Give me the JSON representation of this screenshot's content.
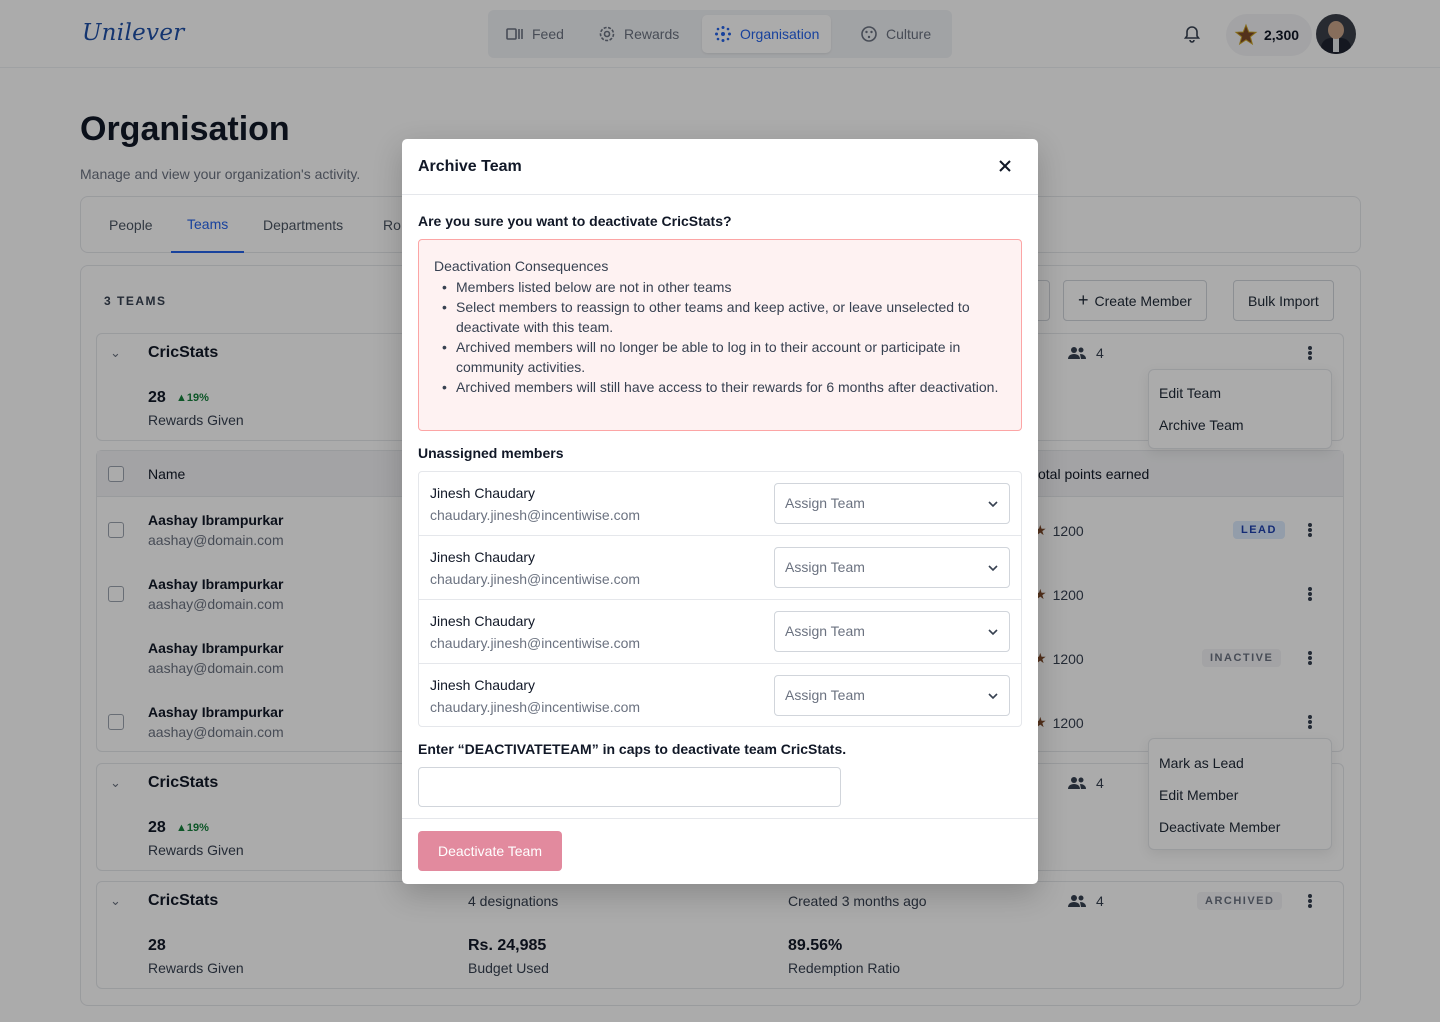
{
  "brand": "Unilever",
  "nav": [
    {
      "label": "Feed",
      "icon": "feed-icon"
    },
    {
      "label": "Rewards",
      "icon": "gear-icon"
    },
    {
      "label": "Organisation",
      "icon": "organisation-icon",
      "active": true
    },
    {
      "label": "Culture",
      "icon": "culture-icon"
    }
  ],
  "points": "2,300",
  "page": {
    "title": "Organisation",
    "subtitle": "Manage and view your organization's activity."
  },
  "tabs": [
    "People",
    "Teams",
    "Departments",
    "Ro"
  ],
  "teams_panel": {
    "count_label": "3 TEAMS",
    "create_member": "Create Member",
    "bulk_import": "Bulk Import",
    "teams": [
      {
        "name": "CricStats",
        "rewards_value": "28",
        "rewards_change": "▲19%",
        "rewards_label": "Rewards Given",
        "members": "4"
      },
      {
        "name": "CricStats",
        "rewards_value": "28",
        "rewards_change": "▲19%",
        "rewards_label": "Rewards Given",
        "members": "4"
      },
      {
        "name": "CricStats",
        "designations": "4 designations",
        "created": "Created 3 months ago",
        "members": "4",
        "status": "ARCHIVED",
        "rewards_value": "28",
        "rewards_label": "Rewards Given",
        "budget_value": "Rs. 24,985",
        "budget_label": "Budget Used",
        "ratio_value": "89.56%",
        "ratio_label": "Redemption Ratio"
      }
    ],
    "member_table": {
      "col_name": "Name",
      "col_points": "otal points earned",
      "rows": [
        {
          "name": "Aashay Ibrampurkar",
          "email": "aashay@domain.com",
          "points": "1200",
          "badge": "LEAD"
        },
        {
          "name": "Aashay Ibrampurkar",
          "email": "aashay@domain.com",
          "points": "1200",
          "badge": ""
        },
        {
          "name": "Aashay Ibrampurkar",
          "email": "aashay@domain.com",
          "points": "1200",
          "badge": "INACTIVE"
        },
        {
          "name": "Aashay Ibrampurkar",
          "email": "aashay@domain.com",
          "points": "1200",
          "badge": ""
        }
      ]
    },
    "team_menu": [
      "Edit Team",
      "Archive Team"
    ],
    "member_menu": [
      "Mark as Lead",
      "Edit Member",
      "Deactivate Member"
    ]
  },
  "modal": {
    "title": "Archive Team",
    "question": "Are you sure you want to deactivate CricStats?",
    "alert_title": "Deactivation Consequences",
    "consequences": [
      "Members listed below are not in other teams",
      "Select members to reassign to other teams and keep active, or leave unselected to deactivate with this team.",
      "Archived members will no longer be able to log in to their account or participate in community activities.",
      "Archived members will still have access to their rewards for 6 months after deactivation."
    ],
    "unassigned_title": "Unassigned members",
    "members": [
      {
        "name": "Jinesh Chaudary",
        "email": "chaudary.jinesh@incentiwise.com",
        "select": "Assign Team"
      },
      {
        "name": "Jinesh Chaudary",
        "email": "chaudary.jinesh@incentiwise.com",
        "select": "Assign Team"
      },
      {
        "name": "Jinesh Chaudary",
        "email": "chaudary.jinesh@incentiwise.com",
        "select": "Assign Team"
      },
      {
        "name": "Jinesh Chaudary",
        "email": "chaudary.jinesh@incentiwise.com",
        "select": "Assign Team"
      }
    ],
    "confirm_prompt": "Enter “DEACTIVATETEAM” in caps to deactivate team CricStats.",
    "confirm_value": "",
    "submit": "Deactivate Team"
  },
  "colors": {
    "accent": "#2563eb",
    "danger_button": "#e28a9e",
    "alert_bg": "#fef2f2",
    "alert_border": "#fca5a5"
  }
}
